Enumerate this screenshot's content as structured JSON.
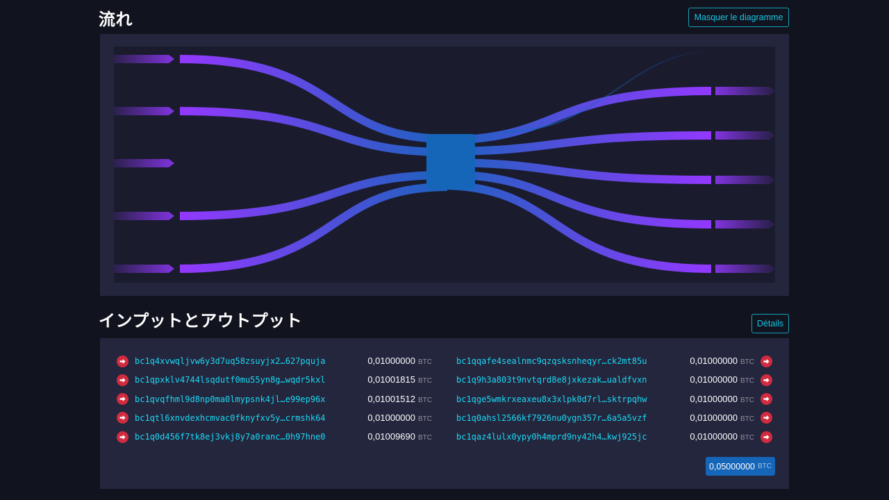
{
  "flow": {
    "title": "流れ",
    "hide_button": "Masquer le diagramme"
  },
  "io": {
    "title": "インプットとアウトプット",
    "details_button": "Détails",
    "inputs": [
      {
        "address": "bc1q4xvwqljvw6y3d7uq58zsuyjx2…627pquja",
        "amount": "0,01000000",
        "unit": "BTC"
      },
      {
        "address": "bc1qpxklv4744lsqdutf0mu55yn8g…wqdr5kxl",
        "amount": "0,01001815",
        "unit": "BTC"
      },
      {
        "address": "bc1qvqfhml9d8np0ma0lmypsnk4jl…e99ep96x",
        "amount": "0,01001512",
        "unit": "BTC"
      },
      {
        "address": "bc1qtl6xnvdexhcmvac0fknyfxv5y…crmshk64",
        "amount": "0,01000000",
        "unit": "BTC"
      },
      {
        "address": "bc1q0d456f7tk8ej3vkj8y7a0ranc…0h97hne0",
        "amount": "0,01009690",
        "unit": "BTC"
      }
    ],
    "outputs": [
      {
        "address": "bc1qqafe4sealnmc9qzqsksnheqyr…ck2mt85u",
        "amount": "0,01000000",
        "unit": "BTC"
      },
      {
        "address": "bc1q9h3a803t9nvtqrd8e8jxkezak…ualdfvxn",
        "amount": "0,01000000",
        "unit": "BTC"
      },
      {
        "address": "bc1qge5wmkrxeaxeu8x3xlpk0d7rl…sktrpqhw",
        "amount": "0,01000000",
        "unit": "BTC"
      },
      {
        "address": "bc1q0ahsl2566kf7926nu0ygn357r…6a5a5vzf",
        "amount": "0,01000000",
        "unit": "BTC"
      },
      {
        "address": "bc1qaz4lulx0ypy0h4mprd9ny42h4…kwj925jc",
        "amount": "0,01000000",
        "unit": "BTC"
      }
    ],
    "total": {
      "amount": "0,05000000",
      "unit": "BTC"
    }
  },
  "colors": {
    "page_bg": "#11131f",
    "panel_bg": "#24263d",
    "flow_purple": "#9338ff",
    "flow_blue": "#1565b8",
    "accent_cyan": "#17a2b8",
    "address_text": "#1bd8f4",
    "arrow_red": "#d12b3f"
  },
  "icons": {
    "input_arrow": "arrow-circle-right-icon",
    "output_arrow": "arrow-circle-right-icon"
  }
}
